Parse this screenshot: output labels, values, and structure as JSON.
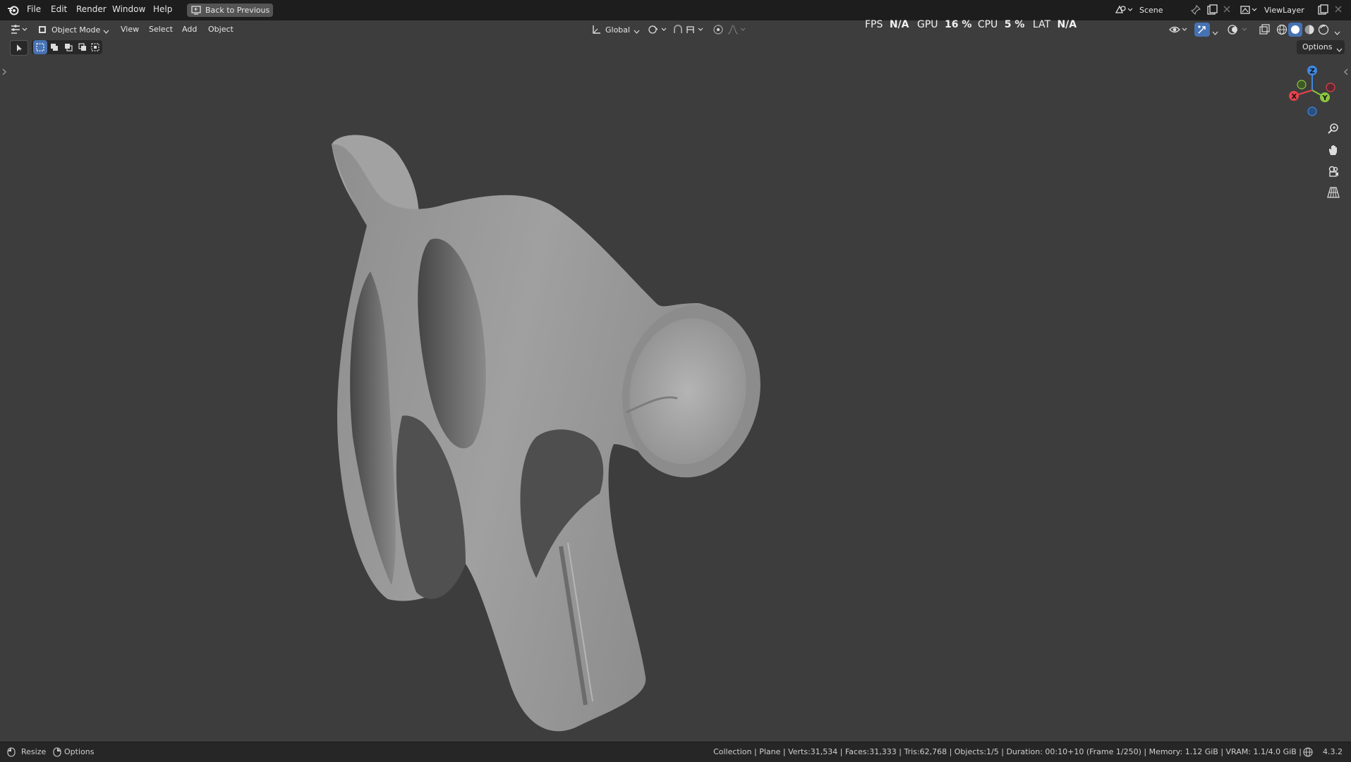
{
  "menubar": {
    "items": [
      "File",
      "Edit",
      "Render",
      "Window",
      "Help"
    ],
    "back_button": "Back to Previous",
    "scene_label": "Scene",
    "viewlayer_label": "ViewLayer"
  },
  "header": {
    "mode": "Object Mode",
    "menus": [
      "View",
      "Select",
      "Add",
      "Object"
    ],
    "transform_orientation": "Global",
    "options_label": "Options"
  },
  "perf_overlay": {
    "fps_label": "FPS",
    "fps_value": "N/A",
    "gpu_label": "GPU",
    "gpu_value": "16 %",
    "cpu_label": "CPU",
    "cpu_value": "5 %",
    "lat_label": "LAT",
    "lat_value": "N/A"
  },
  "gizmo": {
    "z": "Z",
    "y": "Y",
    "x": "X"
  },
  "statusbar": {
    "resize_label": "Resize",
    "options_label": "Options",
    "info": "Collection | Plane | Verts:31,534 | Faces:31,333 | Tris:62,768 | Objects:1/5 | Duration: 00:10+10 (Frame 1/250) | Memory: 1.12 GiB | VRAM: 1.1/4.0 GiB |",
    "version": "4.3.2"
  },
  "colors": {
    "accent": "#4772b3",
    "axis_x": "#e8424c",
    "axis_y": "#8bc53f",
    "axis_z": "#3f87e0"
  }
}
